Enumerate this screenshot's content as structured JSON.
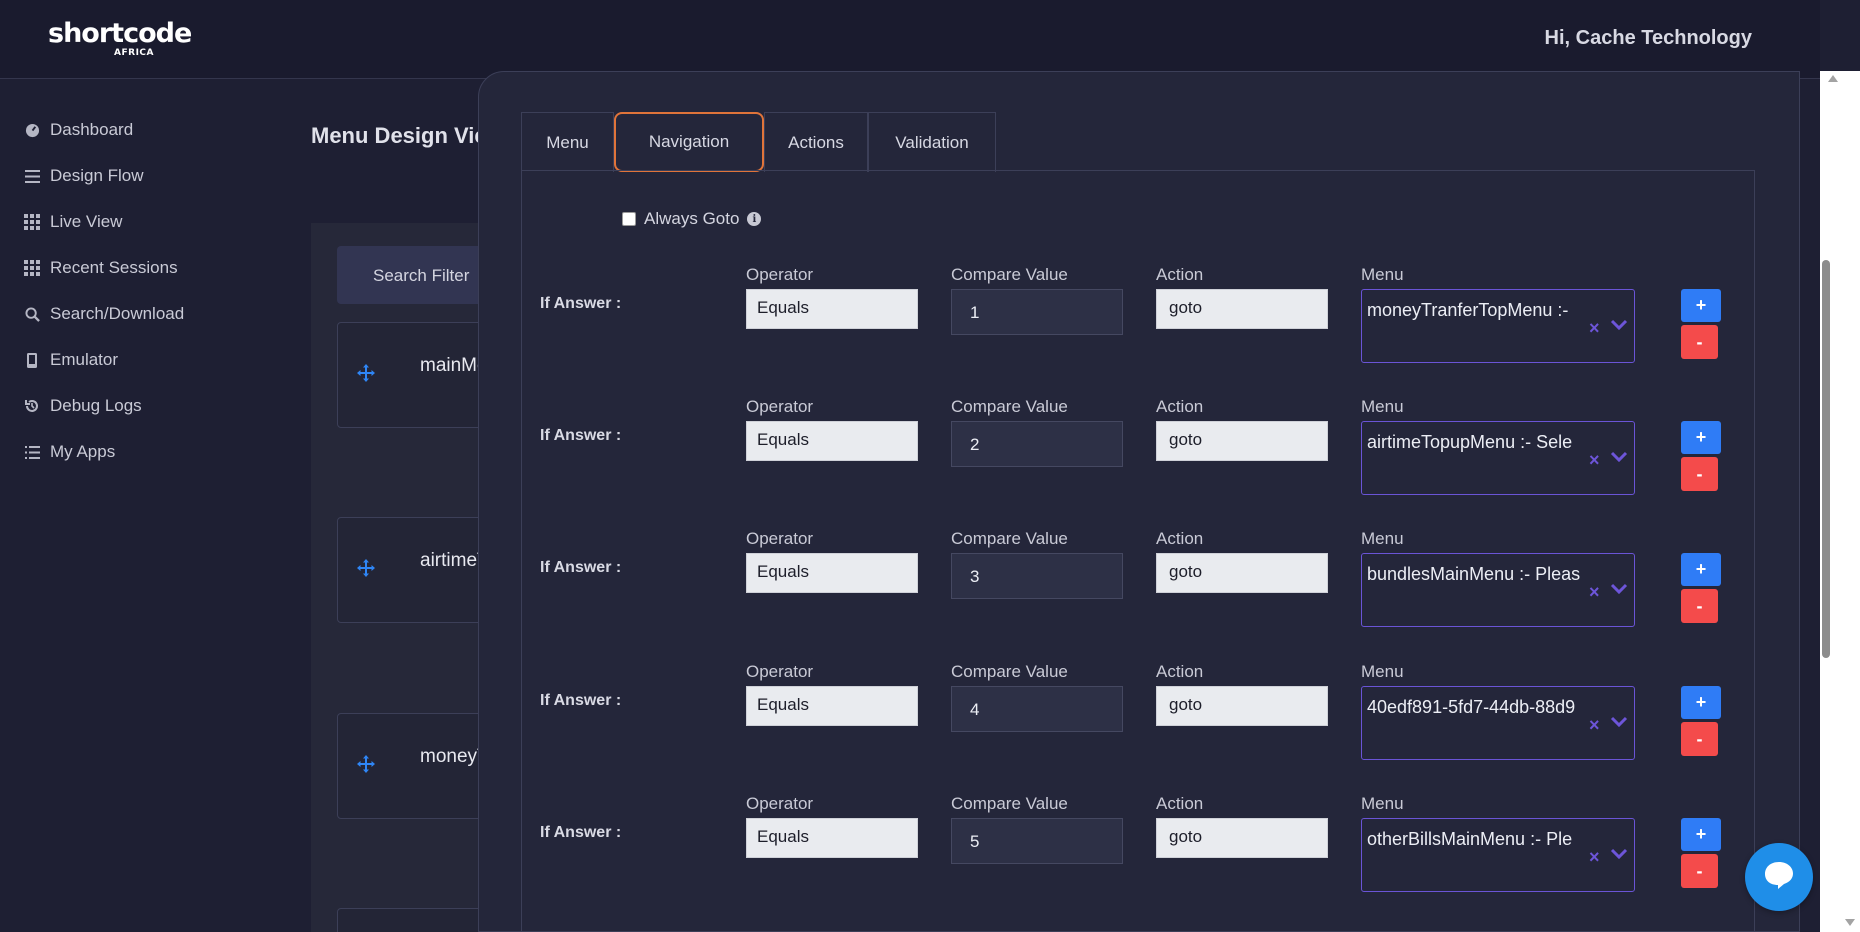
{
  "header": {
    "logo_main": "shortcode",
    "logo_sub": "AFRICA",
    "greeting": "Hi, Cache Technology"
  },
  "sidebar": {
    "items": [
      {
        "label": "Dashboard",
        "icon": "dashboard-icon"
      },
      {
        "label": "Design Flow",
        "icon": "list-icon"
      },
      {
        "label": "Live View",
        "icon": "grid-icon"
      },
      {
        "label": "Recent Sessions",
        "icon": "grid-icon"
      },
      {
        "label": "Search/Download",
        "icon": "search-icon"
      },
      {
        "label": "Emulator",
        "icon": "phone-icon"
      },
      {
        "label": "Debug Logs",
        "icon": "history-icon"
      },
      {
        "label": "My Apps",
        "icon": "list-icon"
      }
    ]
  },
  "main": {
    "title": "Menu Design View",
    "search_filter": "Search Filter",
    "cards": [
      {
        "label": "mainMenu"
      },
      {
        "label": "airtimeTopupMenu"
      },
      {
        "label": "moneyTranferTopMenu"
      }
    ]
  },
  "modal": {
    "tabs": [
      {
        "label": "Menu",
        "active": false
      },
      {
        "label": "Navigation",
        "active": true
      },
      {
        "label": "Actions",
        "active": false
      },
      {
        "label": "Validation",
        "active": false
      }
    ],
    "always_goto_label": "Always Goto",
    "always_goto_checked": false,
    "field_labels": {
      "if_answer": "If Answer :",
      "operator": "Operator",
      "compare_value": "Compare Value",
      "action": "Action",
      "menu": "Menu"
    },
    "rules": [
      {
        "operator": "Equals",
        "compare_value": "1",
        "action": "goto",
        "menu": "moneyTranferTopMenu :- "
      },
      {
        "operator": "Equals",
        "compare_value": "2",
        "action": "goto",
        "menu": "airtimeTopupMenu :- Sele"
      },
      {
        "operator": "Equals",
        "compare_value": "3",
        "action": "goto",
        "menu": "bundlesMainMenu :- Pleas"
      },
      {
        "operator": "Equals",
        "compare_value": "4",
        "action": "goto",
        "menu": "40edf891-5fd7-44db-88d9"
      },
      {
        "operator": "Equals",
        "compare_value": "5",
        "action": "goto",
        "menu": "otherBillsMainMenu :- Ple"
      }
    ],
    "plus_label": "+",
    "minus_label": "-"
  },
  "colors": {
    "accent": "#2f7cf6",
    "danger": "#f44b4b",
    "tab_highlight": "#e0743a",
    "select_border": "#6a54d6",
    "background": "#1e1f33"
  }
}
